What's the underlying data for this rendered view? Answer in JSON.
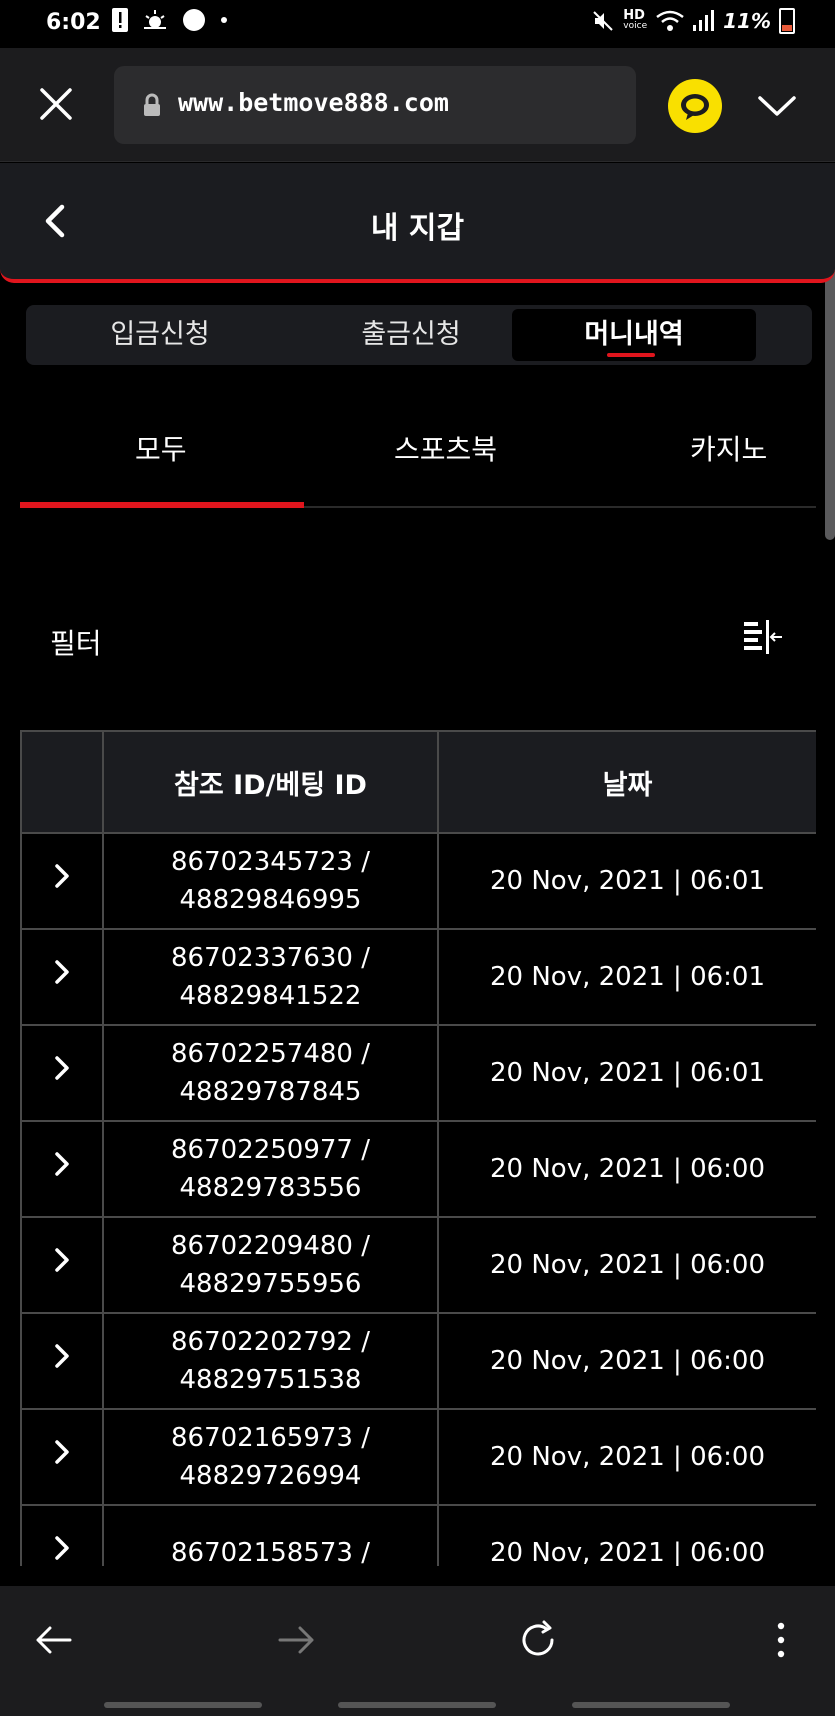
{
  "status_bar": {
    "time": "6:02",
    "hd_label": "HD",
    "voice_label": "voice",
    "battery": "11%"
  },
  "browser": {
    "url": "www.betmove888.com"
  },
  "header": {
    "title": "내 지갑"
  },
  "top_tabs": [
    {
      "label": "입금신청",
      "active": false
    },
    {
      "label": "출금신청",
      "active": false
    },
    {
      "label": "머니내역",
      "active": true
    }
  ],
  "sub_tabs": [
    {
      "label": "모두",
      "active": true
    },
    {
      "label": "스포츠북",
      "active": false
    },
    {
      "label": "카지노",
      "active": false
    }
  ],
  "filter": {
    "label": "필터"
  },
  "table": {
    "headers": [
      "",
      "참조 ID/베팅 ID",
      "날짜"
    ],
    "rows": [
      {
        "ref": "86702345723 /",
        "bet": "48829846995",
        "date": "20 Nov, 2021 | 06:01"
      },
      {
        "ref": "86702337630 /",
        "bet": "48829841522",
        "date": "20 Nov, 2021 | 06:01"
      },
      {
        "ref": "86702257480 /",
        "bet": "48829787845",
        "date": "20 Nov, 2021 | 06:01"
      },
      {
        "ref": "86702250977 /",
        "bet": "48829783556",
        "date": "20 Nov, 2021 | 06:00"
      },
      {
        "ref": "86702209480 /",
        "bet": "48829755956",
        "date": "20 Nov, 2021 | 06:00"
      },
      {
        "ref": "86702202792 /",
        "bet": "48829751538",
        "date": "20 Nov, 2021 | 06:00"
      },
      {
        "ref": "86702165973 /",
        "bet": "48829726994",
        "date": "20 Nov, 2021 | 06:00"
      },
      {
        "ref": "86702158573 /",
        "bet": "",
        "date": "20 Nov, 2021 | 06:00"
      }
    ]
  },
  "colors": {
    "accent": "#e0151d",
    "header_bg": "#1b1c20",
    "talk_yellow": "#f9e000"
  }
}
